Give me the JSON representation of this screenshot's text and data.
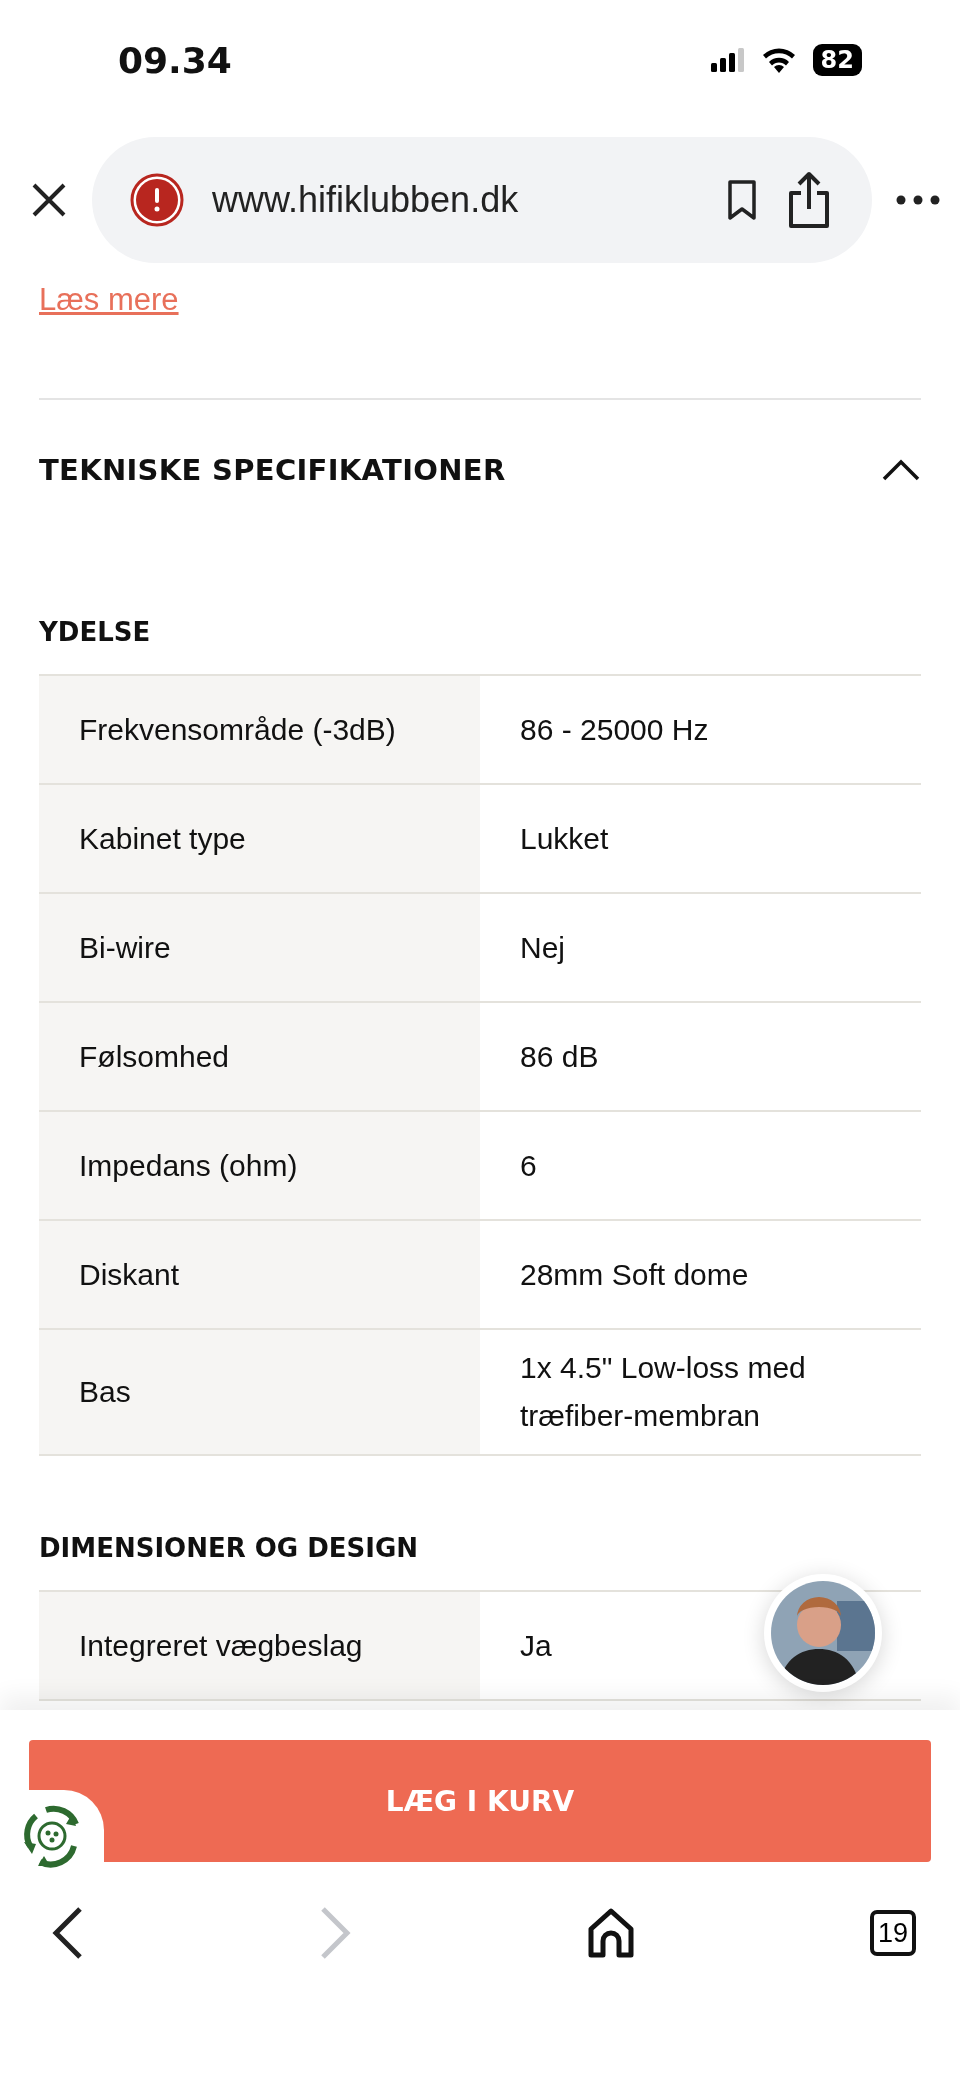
{
  "status_bar": {
    "time": "09.34",
    "battery": "82"
  },
  "browser": {
    "url": "www.hifiklubben.dk"
  },
  "read_more": "Læs mere",
  "specs": {
    "title": "TEKNISKE SPECIFIKATIONER",
    "expanded": true,
    "groups": [
      {
        "title": "YDELSE",
        "rows": [
          {
            "label": "Frekvensområde (-3dB)",
            "value": "86 - 25000 Hz"
          },
          {
            "label": "Kabinet type",
            "value": "Lukket"
          },
          {
            "label": "Bi-wire",
            "value": "Nej"
          },
          {
            "label": "Følsomhed",
            "value": "86 dB"
          },
          {
            "label": "Impedans (ohm)",
            "value": "6"
          },
          {
            "label": "Diskant",
            "value": "28mm Soft dome"
          },
          {
            "label": "Bas",
            "value": "1x 4.5\" Low-loss med træfiber-membran"
          }
        ]
      },
      {
        "title": "DIMENSIONER OG DESIGN",
        "rows": [
          {
            "label": "Integreret vægbeslag",
            "value": "Ja"
          }
        ]
      }
    ]
  },
  "cart_button": "LÆG I KURV",
  "toolbar": {
    "back_disabled": false,
    "forward_disabled": true,
    "tabs_count": "19"
  }
}
